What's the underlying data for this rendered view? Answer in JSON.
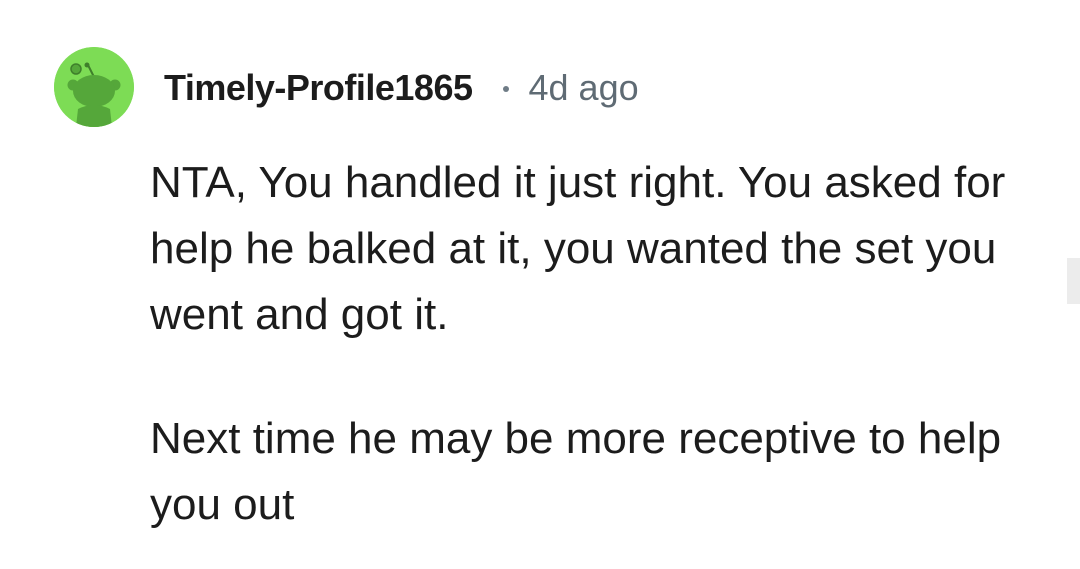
{
  "comment": {
    "author": "Timely-Profile1865",
    "timestamp": "4d ago",
    "paragraphs": [
      "NTA, You handled it just right. You asked for help he balked at it, you wanted the set you went and got it.",
      "Next time he may be more receptive to help you out"
    ],
    "avatar_icon": "reddit-snoo-avatar-icon",
    "colors": {
      "avatar_background": "#7ddc55",
      "avatar_figure": "#55a73a",
      "timestamp_gray": "#5f6b74"
    }
  }
}
